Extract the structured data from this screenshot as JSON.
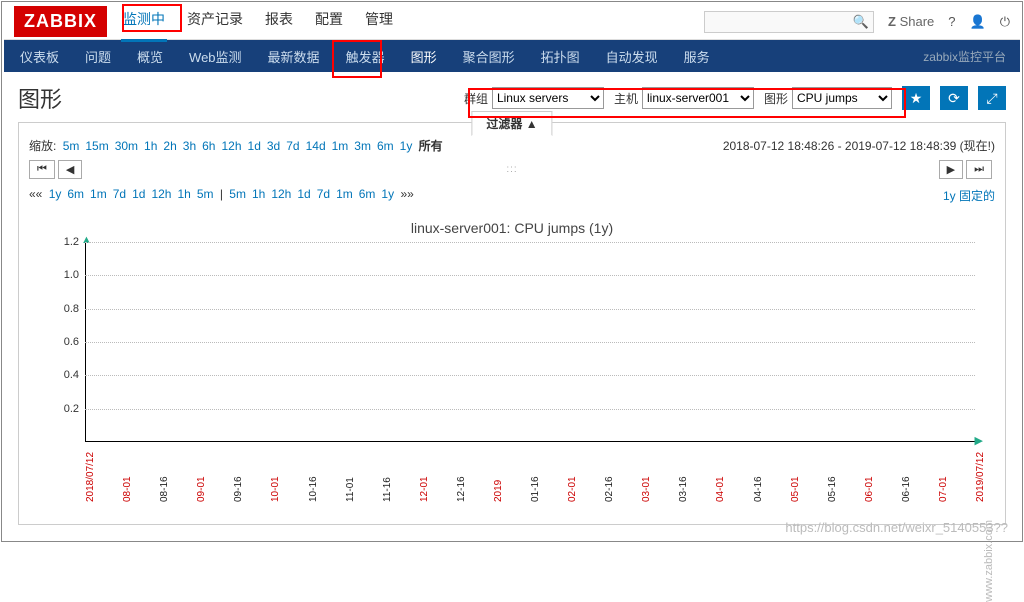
{
  "logo": "ZABBIX",
  "topnav": [
    "监测中",
    "资产记录",
    "报表",
    "配置",
    "管理"
  ],
  "top_active": 0,
  "share": "Share",
  "subnav": [
    "仪表板",
    "问题",
    "概览",
    "Web监测",
    "最新数据",
    "触发器",
    "图形",
    "聚合图形",
    "拓扑图",
    "自动发现",
    "服务"
  ],
  "sub_active": 6,
  "subright": "zabbix监控平台",
  "page_title": "图形",
  "selectors": {
    "group_label": "群组",
    "group_value": "Linux servers",
    "host_label": "主机",
    "host_value": "linux-server001",
    "graph_label": "图形",
    "graph_value": "CPU jumps"
  },
  "filter_tab": "过滤器  ▲",
  "zoom_label": "缩放:",
  "zoom_links": [
    "5m",
    "15m",
    "30m",
    "1h",
    "2h",
    "3h",
    "6h",
    "12h",
    "1d",
    "3d",
    "7d",
    "14d",
    "1m",
    "3m",
    "6m",
    "1y"
  ],
  "zoom_all": "所有",
  "time_range": "2018-07-12 18:48:26 - 2019-07-12 18:48:39 (现在!)",
  "nav_ll": "⏮",
  "nav_l": "◀",
  "nav_r": "▶",
  "nav_rr": "⏭",
  "steps_left_prefix": "«« ",
  "steps_left": [
    "1y",
    "6m",
    "1m",
    "7d",
    "1d",
    "12h",
    "1h",
    "5m"
  ],
  "steps_sep": " | ",
  "steps_right_list": [
    "5m",
    "1h",
    "12h",
    "1d",
    "7d",
    "1m",
    "6m",
    "1y"
  ],
  "steps_right_suffix": " »»",
  "fixed_label": "1y  固定的",
  "chart_data": {
    "type": "line",
    "title": "linux-server001: CPU jumps (1y)",
    "ylim": [
      0,
      1.2
    ],
    "yticks": [
      0.2,
      0.4,
      0.6,
      0.8,
      1.0,
      1.2
    ],
    "xticks": [
      {
        "label": "2018/07/12",
        "red": true
      },
      {
        "label": "08-01",
        "red": true
      },
      {
        "label": "08-16",
        "red": false
      },
      {
        "label": "09-01",
        "red": true
      },
      {
        "label": "09-16",
        "red": false
      },
      {
        "label": "10-01",
        "red": true
      },
      {
        "label": "10-16",
        "red": false
      },
      {
        "label": "11-01",
        "red": false
      },
      {
        "label": "11-16",
        "red": false
      },
      {
        "label": "12-01",
        "red": true
      },
      {
        "label": "12-16",
        "red": false
      },
      {
        "label": "2019",
        "red": true
      },
      {
        "label": "01-16",
        "red": false
      },
      {
        "label": "02-01",
        "red": true
      },
      {
        "label": "02-16",
        "red": false
      },
      {
        "label": "03-01",
        "red": true
      },
      {
        "label": "03-16",
        "red": false
      },
      {
        "label": "04-01",
        "red": true
      },
      {
        "label": "04-16",
        "red": false
      },
      {
        "label": "05-01",
        "red": true
      },
      {
        "label": "05-16",
        "red": false
      },
      {
        "label": "06-01",
        "red": true
      },
      {
        "label": "06-16",
        "red": false
      },
      {
        "label": "07-01",
        "red": true
      },
      {
        "label": "2019/07/12",
        "red": true
      }
    ],
    "series": []
  },
  "watermark_right": "www.zabbix.com",
  "blog_mark": "https://blog.csdn.net/weixr_5140553??"
}
